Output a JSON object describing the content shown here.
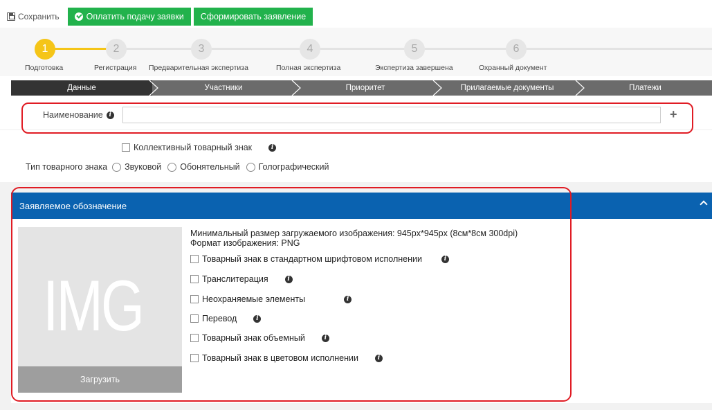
{
  "toolbar": {
    "save_label": "Сохранить",
    "pay_label": "Оплатить подачу заявки",
    "form_label": "Сформировать заявление",
    "accent": "#22b24c"
  },
  "stepper": {
    "current": 1,
    "steps": [
      {
        "num": "1",
        "label": "Подготовка"
      },
      {
        "num": "2",
        "label": "Регистрация"
      },
      {
        "num": "3",
        "label": "Предварительная экспертиза"
      },
      {
        "num": "4",
        "label": "Полная экспертиза"
      },
      {
        "num": "5",
        "label": "Экспертиза завершена"
      },
      {
        "num": "6",
        "label": "Охранный документ"
      }
    ],
    "active_color": "#f5c518"
  },
  "tabs": [
    {
      "label": "Данные",
      "active": true
    },
    {
      "label": "Участники",
      "active": false
    },
    {
      "label": "Приоритет",
      "active": false
    },
    {
      "label": "Прилагаемые документы",
      "active": false
    },
    {
      "label": "Платежи",
      "active": false
    }
  ],
  "name_field": {
    "label": "Наименование",
    "value": "",
    "info_icon": "i",
    "add_icon": "+"
  },
  "collective_label": "Коллективный товарный знак",
  "mark_type": {
    "label": "Тип товарного знака",
    "options": [
      "Звуковой",
      "Обонятельный",
      "Голографический"
    ]
  },
  "designation": {
    "title": "Заявляемое обозначение",
    "header_color": "#0a62b0",
    "image_placeholder": "IMG",
    "upload_label": "Загрузить",
    "min_size": "Минимальный размер загружаемого изображения: 945px*945px (8см*8см 300dpi)",
    "format": "Формат изображения: PNG",
    "options": [
      "Товарный знак в стандартном шрифтовом исполнении",
      "Транслитерация",
      "Неохраняемые элементы",
      "Перевод",
      "Товарный знак объемный",
      "Товарный знак в цветовом исполнении"
    ]
  },
  "highlight_color": "#e01c24"
}
